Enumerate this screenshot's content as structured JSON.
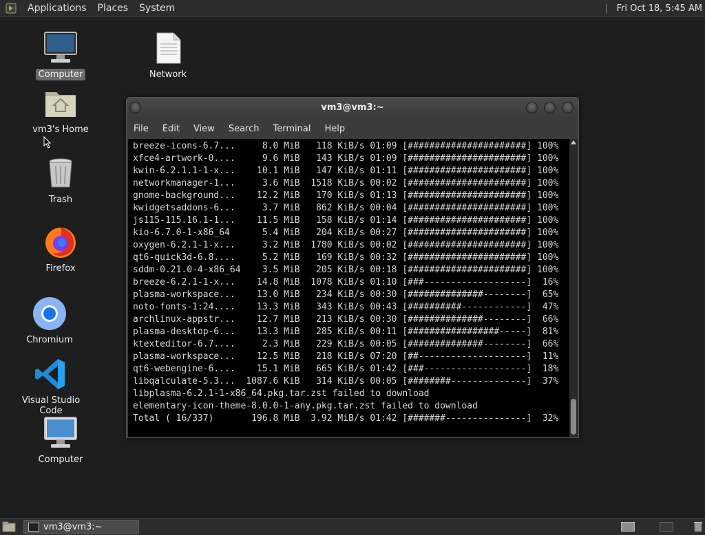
{
  "top_panel": {
    "menus": [
      "Applications",
      "Places",
      "System"
    ],
    "clock": "Fri Oct 18,  5:45 AM"
  },
  "desktop": {
    "icons": [
      {
        "label": "Computer",
        "icon": "monitor-icon"
      },
      {
        "label": "Network",
        "icon": "document-icon"
      },
      {
        "label": "vm3's Home",
        "icon": "home-folder-icon"
      },
      {
        "label": "Trash",
        "icon": "trash-icon"
      },
      {
        "label": "Firefox",
        "icon": "firefox-icon"
      },
      {
        "label": "Chromium",
        "icon": "chromium-icon"
      },
      {
        "label": "Visual Studio Code",
        "icon": "vscode-icon"
      },
      {
        "label": "Computer",
        "icon": "monitor-icon"
      }
    ]
  },
  "terminal": {
    "title": "vm3@vm3:~",
    "menus": [
      "File",
      "Edit",
      "View",
      "Search",
      "Terminal",
      "Help"
    ],
    "lines": [
      "breeze-icons-6.7...     8.0 MiB   118 KiB/s 01:09 [######################] 100%",
      "xfce4-artwork-0....     9.6 MiB   143 KiB/s 01:09 [######################] 100%",
      "kwin-6.2.1.1-1-x...    10.1 MiB   147 KiB/s 01:11 [######################] 100%",
      "networkmanager-1...     3.6 MiB  1518 KiB/s 00:02 [######################] 100%",
      "gnome-background...    12.2 MiB   170 KiB/s 01:13 [######################] 100%",
      "kwidgetsaddons-6...     3.7 MiB   862 KiB/s 00:04 [######################] 100%",
      "js115-115.16.1-1...    11.5 MiB   158 KiB/s 01:14 [######################] 100%",
      "kio-6.7.0-1-x86_64      5.4 MiB   204 KiB/s 00:27 [######################] 100%",
      "oxygen-6.2.1-1-x...     3.2 MiB  1780 KiB/s 00:02 [######################] 100%",
      "qt6-quick3d-6.8....     5.2 MiB   169 KiB/s 00:32 [######################] 100%",
      "sddm-0.21.0-4-x86_64    3.5 MiB   205 KiB/s 00:18 [######################] 100%",
      "breeze-6.2.1-1-x...    14.8 MiB  1078 KiB/s 01:10 [###-------------------]  16%",
      "plasma-workspace...    13.0 MiB   234 KiB/s 00:30 [##############--------]  65%",
      "noto-fonts-1:24....    13.3 MiB   343 KiB/s 00:43 [##########------------]  47%",
      "archlinux-appstr...    12.7 MiB   213 KiB/s 00:30 [##############--------]  66%",
      "plasma-desktop-6...    13.3 MiB   285 KiB/s 00:11 [#################-----]  81%",
      "ktexteditor-6.7....     2.3 MiB   229 KiB/s 00:05 [##############--------]  66%",
      "plasma-workspace...    12.5 MiB   218 KiB/s 07:20 [##--------------------]  11%",
      "qt6-webengine-6....    15.1 MiB   665 KiB/s 01:42 [###-------------------]  18%",
      "libqalculate-5.3...  1087.6 KiB   314 KiB/s 00:05 [########--------------]  37%",
      "libplasma-6.2.1-1-x86_64.pkg.tar.zst failed to download",
      "elementary-icon-theme-8.0.0-1-any.pkg.tar.zst failed to download",
      "Total ( 16/337)       196.8 MiB  3.92 MiB/s 01:42 [#######---------------]  32%"
    ]
  },
  "taskbar": {
    "task_label": "vm3@vm3:~"
  }
}
